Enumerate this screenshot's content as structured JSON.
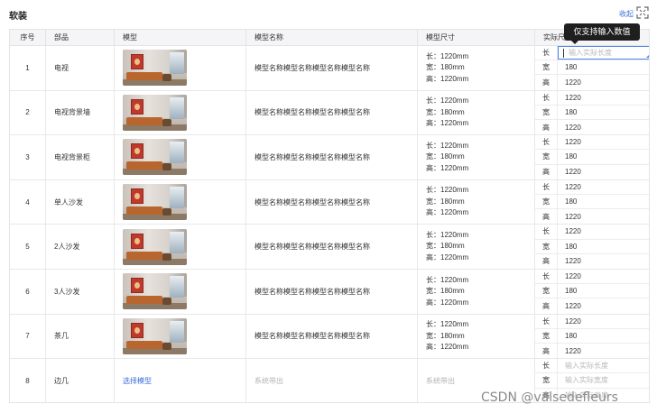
{
  "section": {
    "title": "软装",
    "collapse_label": "收起"
  },
  "tooltip": {
    "text": "仅支持输入数值"
  },
  "table": {
    "columns": [
      "序号",
      "部品",
      "模型",
      "模型名称",
      "模型尺寸",
      "实际尺寸"
    ],
    "dim_labels": {
      "length": "长",
      "width": "宽",
      "height": "高"
    },
    "rows": [
      {
        "index": "1",
        "part": "电视",
        "model_name": "模型名称模型名称模型名称模型名称",
        "size": [
          "长：1220mm",
          "宽：180mm",
          "高：1220mm"
        ],
        "actual": {
          "length": "",
          "width": "180",
          "height": "1220"
        },
        "length_placeholder": "输入实际长度",
        "length_focused": true
      },
      {
        "index": "2",
        "part": "电视背景墙",
        "model_name": "模型名称模型名称模型名称模型名称",
        "size": [
          "长：1220mm",
          "宽：180mm",
          "高：1220mm"
        ],
        "actual": {
          "length": "1220",
          "width": "180",
          "height": "1220"
        }
      },
      {
        "index": "3",
        "part": "电视背景柜",
        "model_name": "模型名称模型名称模型名称模型名称",
        "size": [
          "长：1220mm",
          "宽：180mm",
          "高：1220mm"
        ],
        "actual": {
          "length": "1220",
          "width": "180",
          "height": "1220"
        }
      },
      {
        "index": "4",
        "part": "单人沙发",
        "model_name": "模型名称模型名称模型名称模型名称",
        "size": [
          "长：1220mm",
          "宽：180mm",
          "高：1220mm"
        ],
        "actual": {
          "length": "1220",
          "width": "180",
          "height": "1220"
        }
      },
      {
        "index": "5",
        "part": "2人沙发",
        "model_name": "模型名称模型名称模型名称模型名称",
        "size": [
          "长：1220mm",
          "宽：180mm",
          "高：1220mm"
        ],
        "actual": {
          "length": "1220",
          "width": "180",
          "height": "1220"
        }
      },
      {
        "index": "6",
        "part": "3人沙发",
        "model_name": "模型名称模型名称模型名称模型名称",
        "size": [
          "长：1220mm",
          "宽：180mm",
          "高：1220mm"
        ],
        "actual": {
          "length": "1220",
          "width": "180",
          "height": "1220"
        }
      },
      {
        "index": "7",
        "part": "茶几",
        "model_name": "模型名称模型名称模型名称模型名称",
        "size": [
          "长：1220mm",
          "宽：180mm",
          "高：1220mm"
        ],
        "actual": {
          "length": "1220",
          "width": "180",
          "height": "1220"
        }
      },
      {
        "index": "8",
        "part": "边几",
        "choose_model": "选择模型",
        "model_name_placeholder": "系统带出",
        "size_placeholder": "系统带出",
        "actual_placeholders": {
          "length": "输入实际长度",
          "width": "输入实际宽度",
          "height": "输入实际高度"
        }
      }
    ]
  },
  "watermark": "CSDN @valsedefleurs",
  "colors": {
    "link": "#3b6fd8",
    "focus_border": "#4d84e8",
    "header_bg": "#f5f5f7",
    "tooltip_bg": "#1f1f1f"
  }
}
